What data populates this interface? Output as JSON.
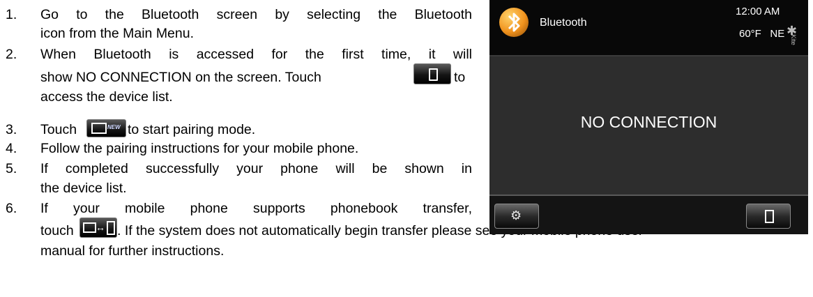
{
  "steps": [
    {
      "num": "1.",
      "lines": [
        "Go to the Bluetooth screen by selecting the Bluetooth",
        "icon from the Main Menu."
      ]
    },
    {
      "num": "2.",
      "lines": [
        "When Bluetooth is accessed for the first time, it will",
        "show NO CONNECTION on the screen. Touch",
        "to",
        "access the device list."
      ]
    },
    {
      "num": "3.",
      "lines": [
        "Touch",
        "to start pairing mode."
      ]
    },
    {
      "num": "4.",
      "lines": [
        "Follow the pairing instructions for your mobile phone."
      ]
    },
    {
      "num": "5.",
      "lines": [
        "If completed successfully your phone will be shown in",
        "the device list."
      ]
    },
    {
      "num": "6.",
      "lines": [
        "If your mobile phone supports phonebook transfer,",
        "touch",
        ". If the system does not automatically begin transfer please see your mobile phone user",
        "manual for further instructions."
      ]
    }
  ],
  "inline_icons": {
    "new_badge": "NEW",
    "transfer_arrow": "↔"
  },
  "screen": {
    "title": "Bluetooth",
    "time": "12:00 AM",
    "temperature": "60°F",
    "direction": "NE",
    "side_label": "Kite",
    "message": "NO CONNECTION",
    "settings_icon": "gear-icon",
    "device_list_icon": "phone-icon"
  },
  "colors": {
    "screen_bg": "#2d2d2d",
    "header_bg": "#080808",
    "logo_orange": "#f0921d"
  }
}
